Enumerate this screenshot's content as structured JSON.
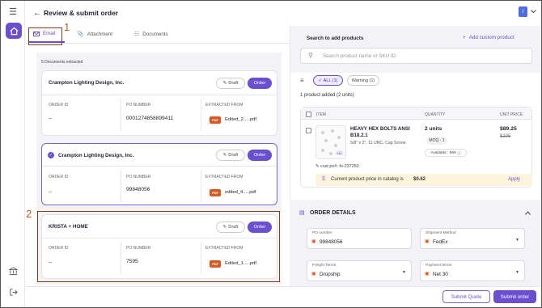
{
  "header": {
    "title": "Review & submit order",
    "avatar_initial": "I"
  },
  "tabs": [
    {
      "label": "Email"
    },
    {
      "label": "Attachment"
    },
    {
      "label": "Documents"
    }
  ],
  "docs_summary": "5 Documents extracted",
  "columns": {
    "order_id": "ORDER ID",
    "po_number": "PO NUMBER",
    "extracted_from": "EXTRACTED FROM"
  },
  "buttons": {
    "draft": "Draft",
    "order": "Order"
  },
  "pdf_badge": "PDF",
  "cards": [
    {
      "name": "Crampton Lighting Design, Inc.",
      "order_id": "--",
      "po_number": "0001274858899411",
      "file": "Edited_2.....pdf",
      "selected": false
    },
    {
      "name": "Crampton Lighting Design, Inc.",
      "order_id": "--",
      "po_number": "99848056",
      "file": "edited_4.....pdf",
      "selected": true
    },
    {
      "name": "KRISTA + HOME",
      "order_id": "--",
      "po_number": "7595",
      "file": "Edited_1.....pdf",
      "selected": false
    }
  ],
  "right": {
    "search_title": "Search to add products",
    "add_custom": "Add custom product",
    "search_placeholder": "Search product name or SKU ID",
    "filters": {
      "all": "ALL (1)",
      "warning": "Warning (1)"
    },
    "summary": "1 product added (2 units)",
    "table_headers": {
      "item": "ITEM",
      "quantity": "QUANTITY",
      "unit_price": "UNIT PRICE"
    },
    "product": {
      "name": "HEAVY HEX BOLTS ANSI B18.2.1",
      "desc": "5/8\" x 2\", 11 UNC, Cap Screw",
      "thumb_badge": "+1c",
      "qty": "2 units",
      "moq": "MOQ - 1",
      "available": "Available : 999",
      "price": "$89.25",
      "old_price": "$105",
      "cust_po": "cust po#: fo-237250",
      "price_note": "Current product price in catalog is ",
      "price_note_value": "$0.62",
      "apply": "Apply"
    }
  },
  "order_details": {
    "title": "ORDER DETAILS",
    "fields": [
      {
        "label": "PO number",
        "value": "99848056"
      },
      {
        "label": "Shipment Method",
        "value": "FedEx"
      },
      {
        "label": "Freight Terms",
        "value": "Dropship"
      },
      {
        "label": "Payment terms",
        "value": "Net 30"
      }
    ]
  },
  "footer": {
    "submit_quote": "Submit Quote",
    "submit_order": "Submit order"
  },
  "annotations": {
    "one": "1",
    "two": "2"
  },
  "colors": {
    "accent": "#6a4fd0",
    "annotation": "#8b3a16",
    "pdf": "#d8591f"
  }
}
